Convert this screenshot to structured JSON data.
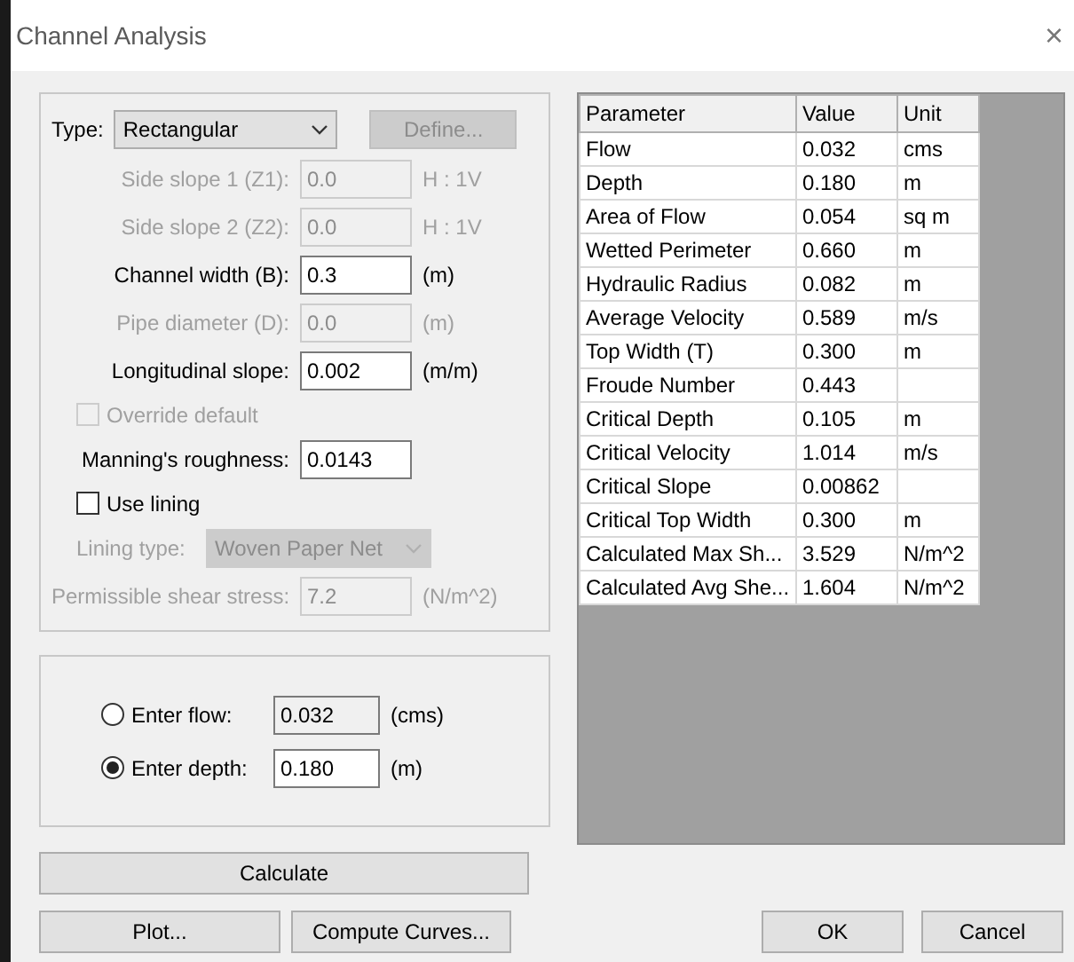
{
  "window": {
    "title": "Channel Analysis",
    "close": "×"
  },
  "section": {
    "type_label": "Type:",
    "type_value": "Rectangular",
    "define_button": {
      "label": "Define...",
      "disabled": true
    },
    "rows": [
      {
        "kind": "field",
        "label": "Side slope 1 (Z1):",
        "value": "0.0",
        "unit": "H : 1V",
        "disabled": true
      },
      {
        "kind": "field",
        "label": "Side slope 2 (Z2):",
        "value": "0.0",
        "unit": "H : 1V",
        "disabled": true
      },
      {
        "kind": "field",
        "label": "Channel width (B):",
        "value": "0.3",
        "unit": "(m)",
        "disabled": false
      },
      {
        "kind": "field",
        "label": "Pipe diameter (D):",
        "value": "0.0",
        "unit": "(m)",
        "disabled": true
      },
      {
        "kind": "field",
        "label": "Longitudinal slope:",
        "value": "0.002",
        "unit": "(m/m)",
        "disabled": false
      },
      {
        "kind": "checkbox",
        "label": "Override default",
        "checked": false,
        "disabled": true
      },
      {
        "kind": "field",
        "label": "Manning's roughness:",
        "value": "0.0143",
        "disabled": false
      },
      {
        "kind": "checkbox",
        "label": "Use lining",
        "checked": false,
        "disabled": false
      },
      {
        "kind": "combo",
        "label": "Lining type:",
        "value": "Woven Paper Net",
        "disabled": true
      },
      {
        "kind": "field",
        "label": "Permissible shear stress:",
        "value": "7.2",
        "unit": "(N/m^2)",
        "disabled": true
      }
    ]
  },
  "input_mode": [
    {
      "label": "Enter flow:",
      "value": "0.032",
      "unit": "(cms)",
      "selected": false
    },
    {
      "label": "Enter depth:",
      "value": "0.180",
      "unit": "(m)",
      "selected": true
    }
  ],
  "table": {
    "columns": [
      "Parameter",
      "Value",
      "Unit"
    ],
    "rows": [
      [
        "Flow",
        "0.032",
        "cms"
      ],
      [
        "Depth",
        "0.180",
        "m"
      ],
      [
        "Area of Flow",
        "0.054",
        "sq m"
      ],
      [
        "Wetted Perimeter",
        "0.660",
        "m"
      ],
      [
        "Hydraulic Radius",
        "0.082",
        "m"
      ],
      [
        "Average Velocity",
        "0.589",
        "m/s"
      ],
      [
        "Top Width (T)",
        "0.300",
        "m"
      ],
      [
        "Froude Number",
        "0.443",
        ""
      ],
      [
        "Critical Depth",
        "0.105",
        "m"
      ],
      [
        "Critical Velocity",
        "1.014",
        "m/s"
      ],
      [
        "Critical Slope",
        "0.00862",
        ""
      ],
      [
        "Critical Top Width",
        "0.300",
        "m"
      ],
      [
        "Calculated Max Sh...",
        "3.529",
        "N/m^2"
      ],
      [
        "Calculated Avg She...",
        "1.604",
        "N/m^2"
      ]
    ]
  },
  "buttons": {
    "calculate": "Calculate",
    "plot": "Plot...",
    "compute": "Compute Curves...",
    "ok": "OK",
    "cancel": "Cancel"
  }
}
